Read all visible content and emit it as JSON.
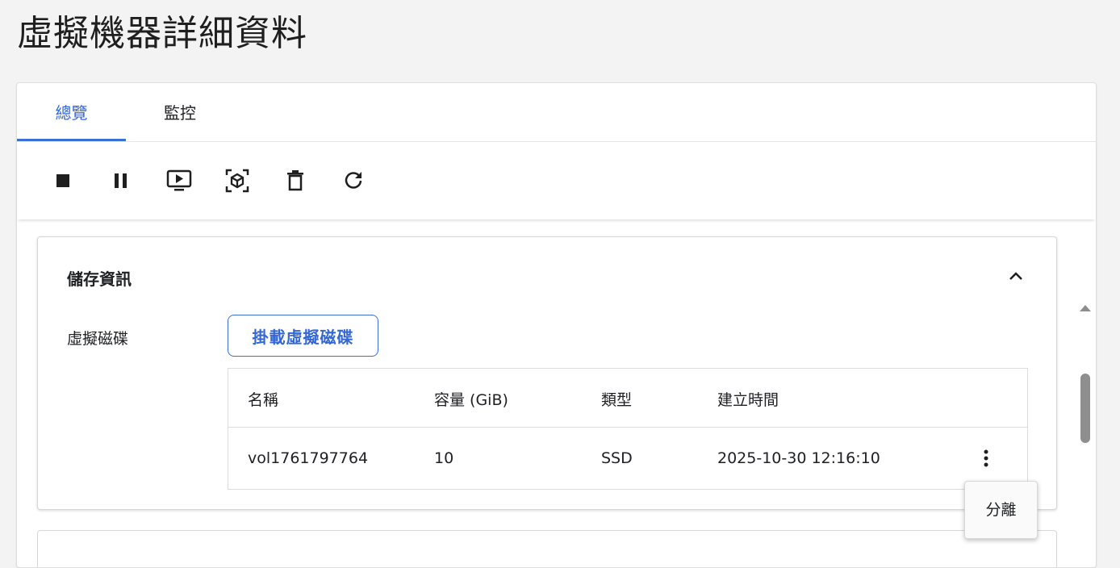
{
  "page": {
    "title": "虛擬機器詳細資料"
  },
  "tabs": [
    {
      "label": "總覽",
      "active": true
    },
    {
      "label": "監控",
      "active": false
    }
  ],
  "toolbar": {
    "icons": [
      "stop-icon",
      "pause-icon",
      "console-icon",
      "snapshot-icon",
      "delete-icon",
      "refresh-icon"
    ]
  },
  "storage": {
    "section_title": "儲存資訊",
    "virtual_disk_label": "虛擬磁碟",
    "attach_button": "掛載虛擬磁碟",
    "table": {
      "headers": [
        "名稱",
        "容量 (GiB)",
        "類型",
        "建立時間"
      ],
      "rows": [
        {
          "name": "vol1761797764",
          "capacity": "10",
          "type": "SSD",
          "created": "2025-10-30 12:16:10"
        }
      ]
    }
  },
  "row_menu": {
    "items": [
      "分離"
    ]
  },
  "colors": {
    "accent": "#3367d6",
    "background": "#f3f3f3",
    "card": "#ffffff"
  }
}
